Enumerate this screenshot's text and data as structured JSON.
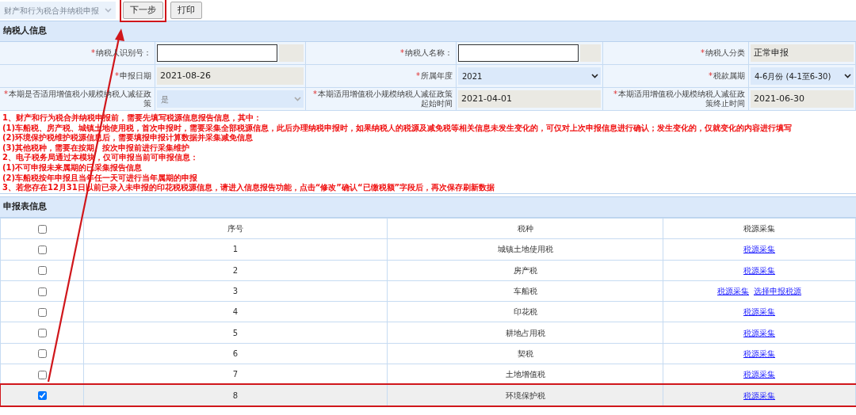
{
  "toolbar": {
    "form_select": {
      "value": "财产和行为税合并纳税申报",
      "disabled": true
    },
    "buttons": [
      {
        "label": "下一步",
        "highlighted": true
      },
      {
        "label": "打印",
        "highlighted": false
      }
    ]
  },
  "taxpayer_info": {
    "title": "纳税人信息",
    "rows": [
      [
        {
          "mark": "*",
          "label": "纳税人识别号：",
          "kind": "input"
        },
        {
          "mark": "*",
          "label": "纳税人名称：",
          "kind": "input"
        },
        {
          "mark": "*",
          "label": "纳税人分类",
          "kind": "readonly",
          "value": "正常申报"
        }
      ],
      [
        {
          "mark": "*",
          "label": "申报日期",
          "kind": "readonly",
          "value": "2021-08-26"
        },
        {
          "mark": "*",
          "label": "所属年度",
          "kind": "select",
          "value": "2021",
          "disabled": false
        },
        {
          "mark": "*",
          "label": "税款属期",
          "kind": "select",
          "value": "4-6月份 (4-1至6-30)",
          "disabled": false
        }
      ],
      [
        {
          "mark": "*",
          "label": "本期是否适用增值税小规模纳税人减征政策",
          "kind": "select",
          "value": "是",
          "disabled": true
        },
        {
          "mark": "*",
          "label": "本期适用增值税小规模纳税人减征政策起始时间",
          "kind": "readonly",
          "value": "2021-04-01"
        },
        {
          "mark": "*",
          "label": "本期适用增值税小规模纳税人减征政策终止时间",
          "kind": "readonly",
          "value": "2021-06-30"
        }
      ]
    ]
  },
  "notes": [
    "1、财产和行为税合并纳税申报前，需要先填写税源信息报告信息，其中：",
    "(1)车船税、房产税、城镇土地使用税，首次申报时，需要采集全部税源信息，此后办理纳税申报时，如果纳税人的税源及减免税等相关信息未发生变化的，可仅对上次申报信息进行确认；发生变化的，仅就变化的内容进行填写",
    "(2)环境保护税维护税源信息后，需要填报申报计算数据并采集减免信息",
    "(3)其他税种，需要在按期、按次申报前进行采集维护",
    "2、电子税务局通过本模块，仅可申报当前可申报信息：",
    "(1)不可申报未来属期的已采集报告信息",
    "(2)车船税按年申报且当年任一天可进行当年属期的申报",
    "3、若您存在12月31日以前已录入未申报的印花税税源信息，请进入信息报告功能，点击“修改”确认“已缴税额”字段后，再次保存刷新数据"
  ],
  "declaration_table": {
    "title": "申报表信息",
    "select_all": false,
    "columns": [
      "序号",
      "税种",
      "税源采集"
    ],
    "rows": [
      {
        "selected": false,
        "highlighted": false,
        "number": "1",
        "tax_type": "城镇土地使用税",
        "links": [
          "税源采集"
        ]
      },
      {
        "selected": false,
        "highlighted": false,
        "number": "2",
        "tax_type": "房产税",
        "links": [
          "税源采集"
        ]
      },
      {
        "selected": false,
        "highlighted": false,
        "number": "3",
        "tax_type": "车船税",
        "links": [
          "税源采集",
          "选择申报税源"
        ]
      },
      {
        "selected": false,
        "highlighted": false,
        "number": "4",
        "tax_type": "印花税",
        "links": [
          "税源采集"
        ]
      },
      {
        "selected": false,
        "highlighted": false,
        "number": "5",
        "tax_type": "耕地占用税",
        "links": [
          "税源采集"
        ]
      },
      {
        "selected": false,
        "highlighted": false,
        "number": "6",
        "tax_type": "契税",
        "links": [
          "税源采集"
        ]
      },
      {
        "selected": false,
        "highlighted": false,
        "number": "7",
        "tax_type": "土地增值税",
        "links": [
          "税源采集"
        ]
      },
      {
        "selected": true,
        "highlighted": true,
        "number": "8",
        "tax_type": "环境保护税",
        "links": [
          "税源采集"
        ]
      }
    ]
  },
  "annotation_arrow": true
}
